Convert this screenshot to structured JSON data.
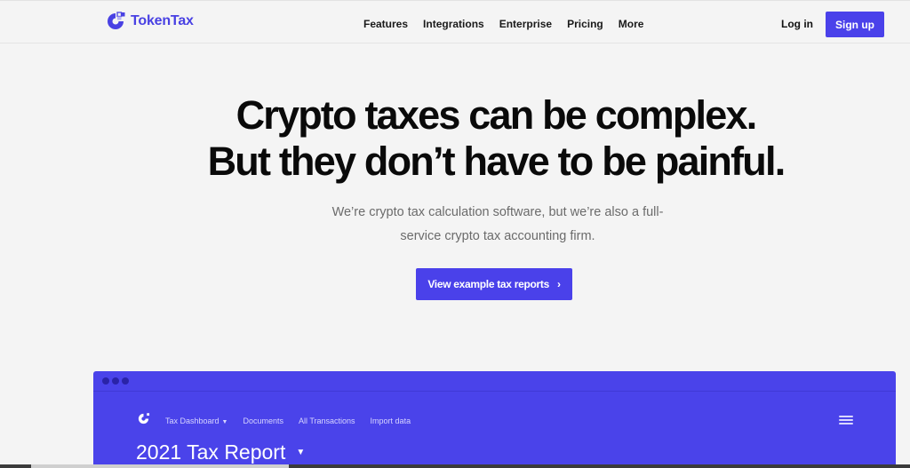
{
  "brand": {
    "name": "TokenTax",
    "accent": "#4a41ea"
  },
  "nav": {
    "links": [
      "Features",
      "Integrations",
      "Enterprise",
      "Pricing",
      "More"
    ],
    "login_label": "Log in",
    "signup_label": "Sign up"
  },
  "hero": {
    "title_line1": "Crypto taxes can be complex.",
    "title_line2": "But they don’t have to be painful.",
    "subtitle_line1": "We’re crypto tax calculation software, but we’re also a full-",
    "subtitle_line2": "service crypto tax accounting firm.",
    "cta_label": "View example tax reports",
    "cta_icon": "chevron-right-icon"
  },
  "preview": {
    "nav": [
      "Tax Dashboard",
      "Documents",
      "All Transactions",
      "Import data"
    ],
    "title": "2021 Tax Report",
    "menu_icon": "hamburger-icon"
  }
}
